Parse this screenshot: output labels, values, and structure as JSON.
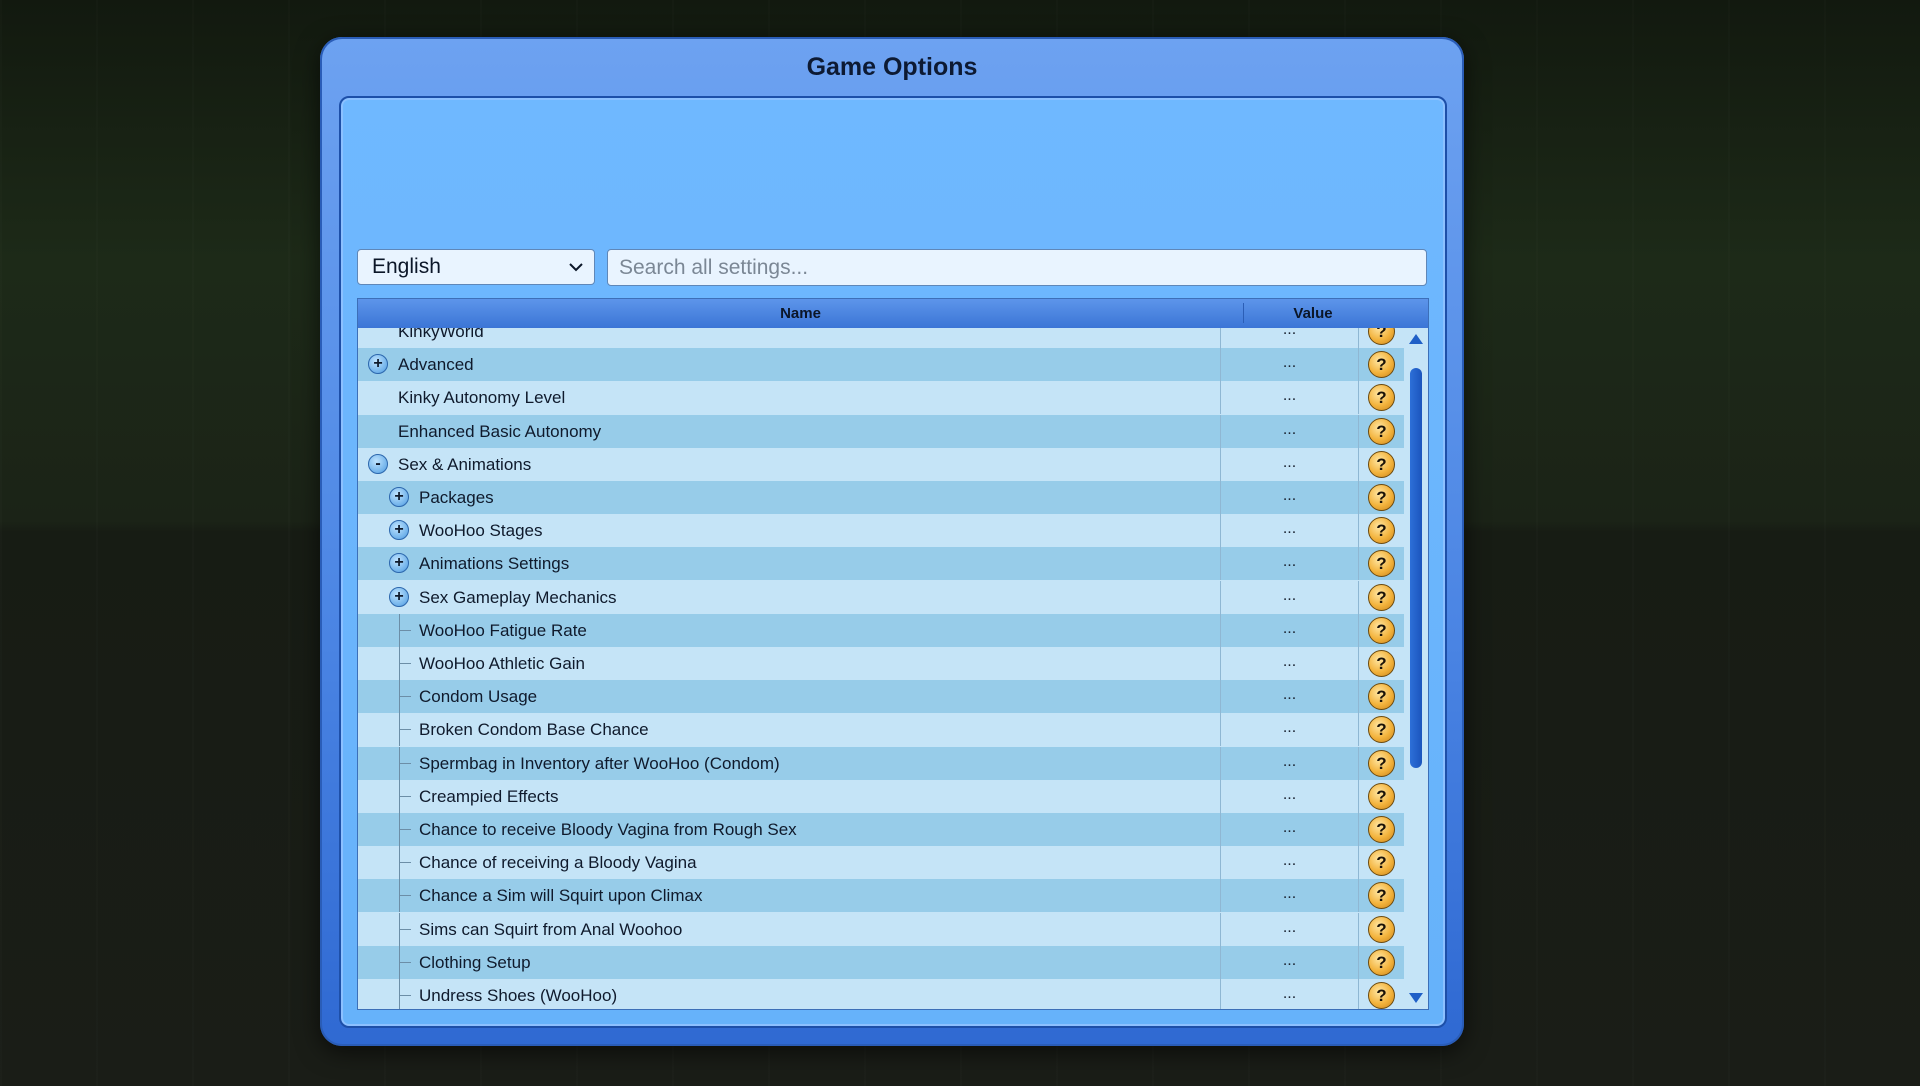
{
  "dialog": {
    "title": "Game Options"
  },
  "language": {
    "selected": "English"
  },
  "search": {
    "placeholder": "Search all settings..."
  },
  "table": {
    "headers": {
      "name": "Name",
      "value": "Value"
    },
    "rows": [
      {
        "label": "KinkyWorld",
        "level": 0,
        "expander": "",
        "value": "..."
      },
      {
        "label": "Advanced",
        "level": 0,
        "expander": "+",
        "value": "..."
      },
      {
        "label": "Kinky Autonomy Level",
        "level": 0,
        "expander": "",
        "value": "..."
      },
      {
        "label": "Enhanced Basic Autonomy",
        "level": 0,
        "expander": "",
        "value": "..."
      },
      {
        "label": "Sex & Animations",
        "level": 0,
        "expander": "-",
        "value": "..."
      },
      {
        "label": "Packages",
        "level": 1,
        "expander": "+",
        "value": "..."
      },
      {
        "label": "WooHoo Stages",
        "level": 1,
        "expander": "+",
        "value": "..."
      },
      {
        "label": "Animations Settings",
        "level": 1,
        "expander": "+",
        "value": "..."
      },
      {
        "label": "Sex Gameplay Mechanics",
        "level": 1,
        "expander": "+",
        "value": "..."
      },
      {
        "label": "WooHoo Fatigue Rate",
        "level": 1,
        "expander": "",
        "value": "..."
      },
      {
        "label": "WooHoo Athletic Gain",
        "level": 1,
        "expander": "",
        "value": "..."
      },
      {
        "label": "Condom Usage",
        "level": 1,
        "expander": "",
        "value": "..."
      },
      {
        "label": "Broken Condom Base Chance",
        "level": 1,
        "expander": "",
        "value": "..."
      },
      {
        "label": "Spermbag in Inventory after WooHoo (Condom)",
        "level": 1,
        "expander": "",
        "value": "..."
      },
      {
        "label": "Creampied Effects",
        "level": 1,
        "expander": "",
        "value": "..."
      },
      {
        "label": "Chance to receive Bloody Vagina from Rough Sex",
        "level": 1,
        "expander": "",
        "value": "..."
      },
      {
        "label": "Chance of receiving a Bloody Vagina",
        "level": 1,
        "expander": "",
        "value": "..."
      },
      {
        "label": "Chance a Sim will Squirt upon Climax",
        "level": 1,
        "expander": "",
        "value": "..."
      },
      {
        "label": "Sims can Squirt from Anal Woohoo",
        "level": 1,
        "expander": "",
        "value": "..."
      },
      {
        "label": "Clothing Setup",
        "level": 1,
        "expander": "",
        "value": "..."
      },
      {
        "label": "Undress Shoes (WooHoo)",
        "level": 1,
        "expander": "",
        "value": "..."
      },
      {
        "label": "",
        "level": 0,
        "expander": "+",
        "value": ""
      }
    ],
    "help_symbol": "?"
  },
  "icons": {
    "help": "question-mark-icon",
    "expand": "plus-icon",
    "collapse": "minus-icon",
    "dropdown": "chevron-down-icon",
    "scroll_up": "triangle-up-icon",
    "scroll_down": "triangle-down-icon"
  },
  "colors": {
    "dialog_accent": "#4a84e3",
    "row_alt": "#97cce9",
    "row_normal": "#c5e4f7",
    "help_button": "#f3b33c"
  }
}
